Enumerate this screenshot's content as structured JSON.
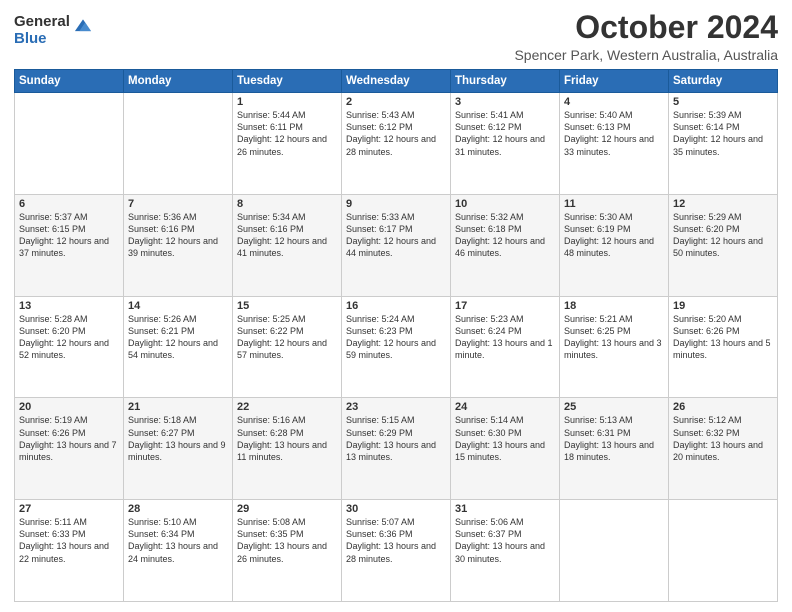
{
  "logo": {
    "general": "General",
    "blue": "Blue"
  },
  "header": {
    "title": "October 2024",
    "subtitle": "Spencer Park, Western Australia, Australia"
  },
  "weekdays": [
    "Sunday",
    "Monday",
    "Tuesday",
    "Wednesday",
    "Thursday",
    "Friday",
    "Saturday"
  ],
  "weeks": [
    [
      {
        "day": "",
        "sunrise": "",
        "sunset": "",
        "daylight": ""
      },
      {
        "day": "",
        "sunrise": "",
        "sunset": "",
        "daylight": ""
      },
      {
        "day": "1",
        "sunrise": "Sunrise: 5:44 AM",
        "sunset": "Sunset: 6:11 PM",
        "daylight": "Daylight: 12 hours and 26 minutes."
      },
      {
        "day": "2",
        "sunrise": "Sunrise: 5:43 AM",
        "sunset": "Sunset: 6:12 PM",
        "daylight": "Daylight: 12 hours and 28 minutes."
      },
      {
        "day": "3",
        "sunrise": "Sunrise: 5:41 AM",
        "sunset": "Sunset: 6:12 PM",
        "daylight": "Daylight: 12 hours and 31 minutes."
      },
      {
        "day": "4",
        "sunrise": "Sunrise: 5:40 AM",
        "sunset": "Sunset: 6:13 PM",
        "daylight": "Daylight: 12 hours and 33 minutes."
      },
      {
        "day": "5",
        "sunrise": "Sunrise: 5:39 AM",
        "sunset": "Sunset: 6:14 PM",
        "daylight": "Daylight: 12 hours and 35 minutes."
      }
    ],
    [
      {
        "day": "6",
        "sunrise": "Sunrise: 5:37 AM",
        "sunset": "Sunset: 6:15 PM",
        "daylight": "Daylight: 12 hours and 37 minutes."
      },
      {
        "day": "7",
        "sunrise": "Sunrise: 5:36 AM",
        "sunset": "Sunset: 6:16 PM",
        "daylight": "Daylight: 12 hours and 39 minutes."
      },
      {
        "day": "8",
        "sunrise": "Sunrise: 5:34 AM",
        "sunset": "Sunset: 6:16 PM",
        "daylight": "Daylight: 12 hours and 41 minutes."
      },
      {
        "day": "9",
        "sunrise": "Sunrise: 5:33 AM",
        "sunset": "Sunset: 6:17 PM",
        "daylight": "Daylight: 12 hours and 44 minutes."
      },
      {
        "day": "10",
        "sunrise": "Sunrise: 5:32 AM",
        "sunset": "Sunset: 6:18 PM",
        "daylight": "Daylight: 12 hours and 46 minutes."
      },
      {
        "day": "11",
        "sunrise": "Sunrise: 5:30 AM",
        "sunset": "Sunset: 6:19 PM",
        "daylight": "Daylight: 12 hours and 48 minutes."
      },
      {
        "day": "12",
        "sunrise": "Sunrise: 5:29 AM",
        "sunset": "Sunset: 6:20 PM",
        "daylight": "Daylight: 12 hours and 50 minutes."
      }
    ],
    [
      {
        "day": "13",
        "sunrise": "Sunrise: 5:28 AM",
        "sunset": "Sunset: 6:20 PM",
        "daylight": "Daylight: 12 hours and 52 minutes."
      },
      {
        "day": "14",
        "sunrise": "Sunrise: 5:26 AM",
        "sunset": "Sunset: 6:21 PM",
        "daylight": "Daylight: 12 hours and 54 minutes."
      },
      {
        "day": "15",
        "sunrise": "Sunrise: 5:25 AM",
        "sunset": "Sunset: 6:22 PM",
        "daylight": "Daylight: 12 hours and 57 minutes."
      },
      {
        "day": "16",
        "sunrise": "Sunrise: 5:24 AM",
        "sunset": "Sunset: 6:23 PM",
        "daylight": "Daylight: 12 hours and 59 minutes."
      },
      {
        "day": "17",
        "sunrise": "Sunrise: 5:23 AM",
        "sunset": "Sunset: 6:24 PM",
        "daylight": "Daylight: 13 hours and 1 minute."
      },
      {
        "day": "18",
        "sunrise": "Sunrise: 5:21 AM",
        "sunset": "Sunset: 6:25 PM",
        "daylight": "Daylight: 13 hours and 3 minutes."
      },
      {
        "day": "19",
        "sunrise": "Sunrise: 5:20 AM",
        "sunset": "Sunset: 6:26 PM",
        "daylight": "Daylight: 13 hours and 5 minutes."
      }
    ],
    [
      {
        "day": "20",
        "sunrise": "Sunrise: 5:19 AM",
        "sunset": "Sunset: 6:26 PM",
        "daylight": "Daylight: 13 hours and 7 minutes."
      },
      {
        "day": "21",
        "sunrise": "Sunrise: 5:18 AM",
        "sunset": "Sunset: 6:27 PM",
        "daylight": "Daylight: 13 hours and 9 minutes."
      },
      {
        "day": "22",
        "sunrise": "Sunrise: 5:16 AM",
        "sunset": "Sunset: 6:28 PM",
        "daylight": "Daylight: 13 hours and 11 minutes."
      },
      {
        "day": "23",
        "sunrise": "Sunrise: 5:15 AM",
        "sunset": "Sunset: 6:29 PM",
        "daylight": "Daylight: 13 hours and 13 minutes."
      },
      {
        "day": "24",
        "sunrise": "Sunrise: 5:14 AM",
        "sunset": "Sunset: 6:30 PM",
        "daylight": "Daylight: 13 hours and 15 minutes."
      },
      {
        "day": "25",
        "sunrise": "Sunrise: 5:13 AM",
        "sunset": "Sunset: 6:31 PM",
        "daylight": "Daylight: 13 hours and 18 minutes."
      },
      {
        "day": "26",
        "sunrise": "Sunrise: 5:12 AM",
        "sunset": "Sunset: 6:32 PM",
        "daylight": "Daylight: 13 hours and 20 minutes."
      }
    ],
    [
      {
        "day": "27",
        "sunrise": "Sunrise: 5:11 AM",
        "sunset": "Sunset: 6:33 PM",
        "daylight": "Daylight: 13 hours and 22 minutes."
      },
      {
        "day": "28",
        "sunrise": "Sunrise: 5:10 AM",
        "sunset": "Sunset: 6:34 PM",
        "daylight": "Daylight: 13 hours and 24 minutes."
      },
      {
        "day": "29",
        "sunrise": "Sunrise: 5:08 AM",
        "sunset": "Sunset: 6:35 PM",
        "daylight": "Daylight: 13 hours and 26 minutes."
      },
      {
        "day": "30",
        "sunrise": "Sunrise: 5:07 AM",
        "sunset": "Sunset: 6:36 PM",
        "daylight": "Daylight: 13 hours and 28 minutes."
      },
      {
        "day": "31",
        "sunrise": "Sunrise: 5:06 AM",
        "sunset": "Sunset: 6:37 PM",
        "daylight": "Daylight: 13 hours and 30 minutes."
      },
      {
        "day": "",
        "sunrise": "",
        "sunset": "",
        "daylight": ""
      },
      {
        "day": "",
        "sunrise": "",
        "sunset": "",
        "daylight": ""
      }
    ]
  ]
}
